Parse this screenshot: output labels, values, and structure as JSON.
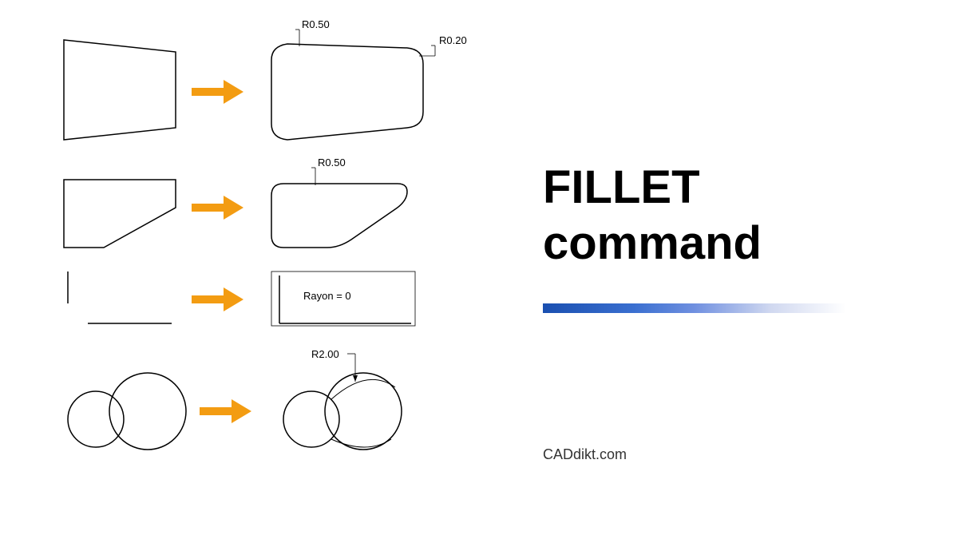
{
  "title_line1": "FILLET",
  "title_line2": "command",
  "attribution": "CADdikt.com",
  "examples": [
    {
      "label_r1": "R0.50",
      "label_r2": "R0.20"
    },
    {
      "label_r1": "R0.50"
    },
    {
      "label_rayon": "Rayon = 0"
    },
    {
      "label_r1": "R2.00"
    }
  ]
}
